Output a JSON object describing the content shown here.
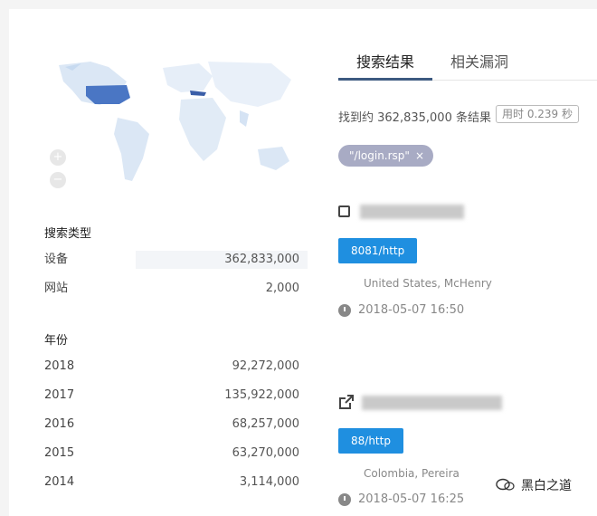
{
  "tabs": {
    "search_results": "搜索结果",
    "related_vulns": "相关漏洞"
  },
  "results": {
    "count_text": "找到约 362,835,000 条结果",
    "time_text": "用时 0.239 秒",
    "query_tag": "\"/login.rsp\"",
    "query_tag_close": "×"
  },
  "search_type": {
    "title": "搜索类型",
    "rows": [
      {
        "label": "设备",
        "value": "362,833,000"
      },
      {
        "label": "网站",
        "value": "2,000"
      }
    ]
  },
  "year": {
    "title": "年份",
    "rows": [
      {
        "label": "2018",
        "value": "92,272,000"
      },
      {
        "label": "2017",
        "value": "135,922,000"
      },
      {
        "label": "2016",
        "value": "68,257,000"
      },
      {
        "label": "2015",
        "value": "63,270,000"
      },
      {
        "label": "2014",
        "value": "3,114,000"
      }
    ]
  },
  "entries": [
    {
      "port": "8081/http",
      "location": "United States, McHenry",
      "timestamp": "2018-05-07 16:50",
      "icon": "checkbox-icon"
    },
    {
      "port": "88/http",
      "location": "Colombia, Pereira",
      "timestamp": "2018-05-07 16:25",
      "icon": "external-link-icon"
    }
  ],
  "map": {
    "zoom_in": "+",
    "zoom_out": "−"
  },
  "watermark": "黑白之道",
  "colors": {
    "accent": "#3d5a80",
    "port_badge": "#1f8fe0",
    "tag": "#a8abc4",
    "map_high": "#4a76c4",
    "map_low": "#d9e6f5"
  }
}
